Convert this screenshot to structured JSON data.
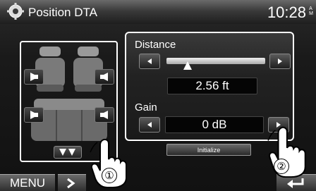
{
  "header": {
    "title": "Position DTA",
    "clock": "10:28",
    "clock_ampm": "AM"
  },
  "adjust": {
    "distance_label": "Distance",
    "distance_value": "2.56 ft",
    "distance_level": 0.2,
    "gain_label": "Gain",
    "gain_value": "0 dB"
  },
  "initialize_label": "Initialize",
  "bottom": {
    "menu_label": "MENU"
  },
  "callouts": {
    "one": "①",
    "two": "②"
  },
  "icons": {
    "header": "gear-icon",
    "speaker": "speaker-icon",
    "left_arrow": "left-arrow-icon",
    "right_arrow": "right-arrow-icon",
    "seat_mode": "seat-mode-icon",
    "back": "back-icon",
    "next": "chevron-right-icon",
    "hand": "hand-pointer-icon"
  }
}
